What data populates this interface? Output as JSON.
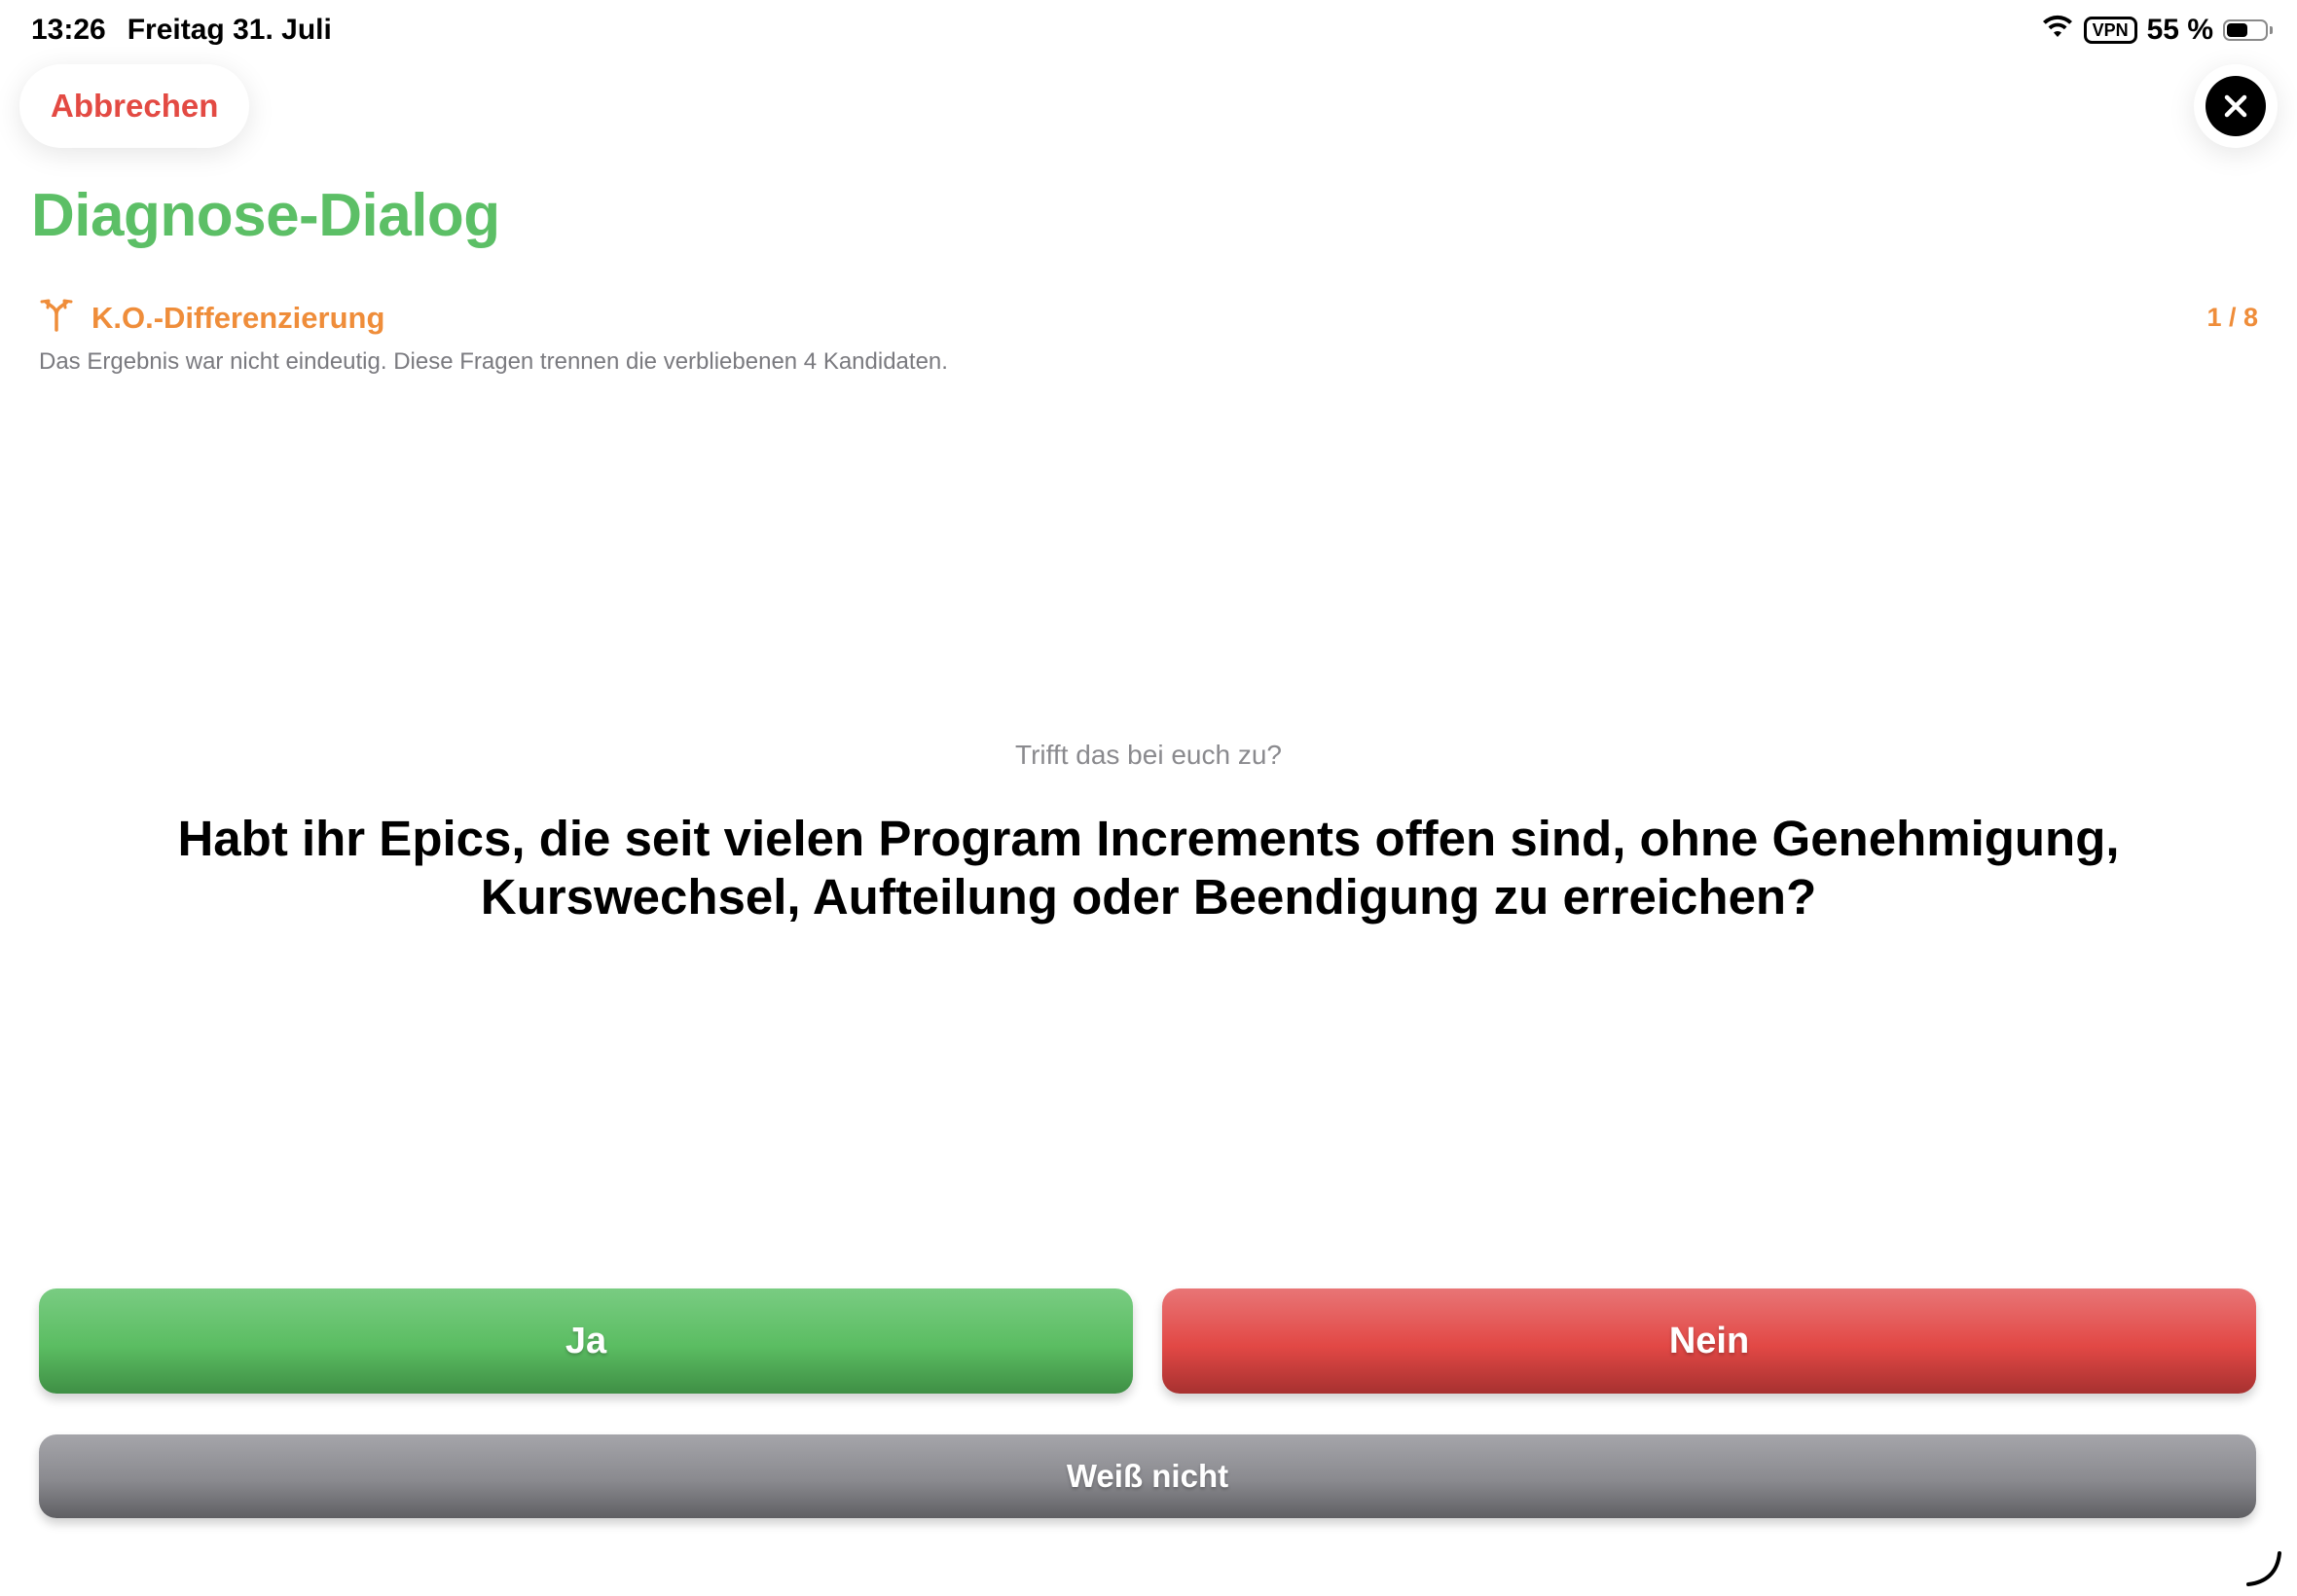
{
  "status_bar": {
    "time": "13:26",
    "date": "Freitag 31. Juli",
    "vpn": "VPN",
    "battery_text": "55 %",
    "battery_level": 0.55
  },
  "header": {
    "cancel_label": "Abbrechen",
    "close_icon": "xmark-icon"
  },
  "page": {
    "title": "Diagnose-Dialog"
  },
  "section": {
    "icon": "fork-branch-icon",
    "title": "K.O.-Differenzierung",
    "step": "1 / 8",
    "description": "Das Ergebnis war nicht eindeutig. Diese Fragen trennen die verbliebenen 4 Kandidaten."
  },
  "question": {
    "prompt": "Trifft das bei euch zu?",
    "text": "Habt ihr Epics, die seit vielen Program Increments offen sind, ohne Genehmigung, Kurswechsel, Aufteilung oder Beendigung zu erreichen?"
  },
  "answers": {
    "yes": "Ja",
    "no": "Nein",
    "unknown": "Weiß nicht"
  },
  "colors": {
    "accent_green": "#5cbf66",
    "accent_orange": "#ef8d3a",
    "cancel_red": "#e34a43",
    "yes_green": "#5bbd62",
    "no_red": "#e24845",
    "unknown_gray": "#8a8a8f"
  }
}
